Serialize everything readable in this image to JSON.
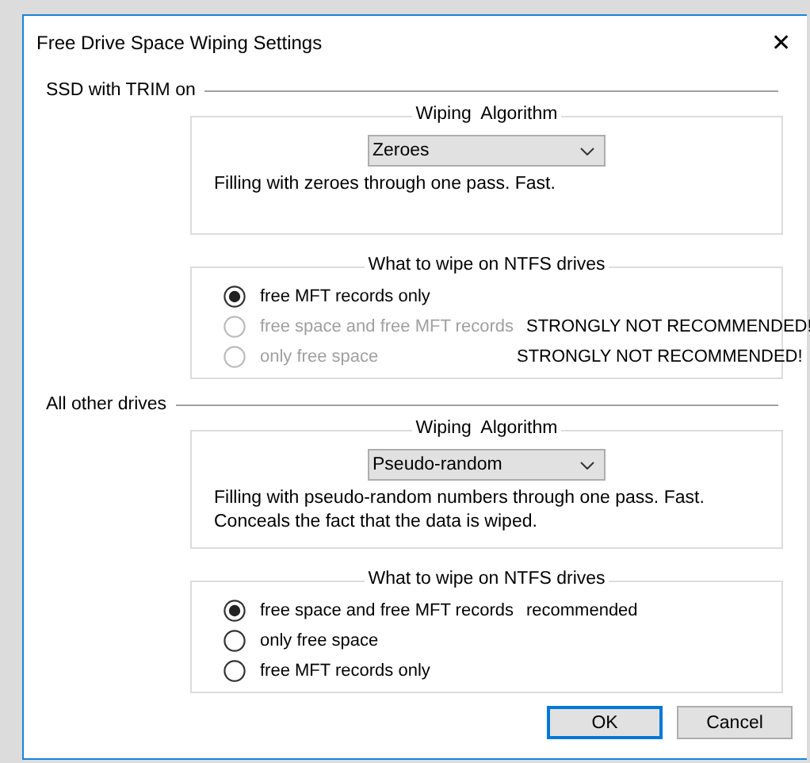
{
  "window": {
    "title": "Free Drive Space Wiping Settings",
    "close": "✕"
  },
  "sections": [
    {
      "title": "SSD with TRIM on",
      "algorithm": {
        "title": "Wiping  Algorithm",
        "value": "Zeroes",
        "description": "Filling with zeroes through one pass. Fast."
      },
      "ntfs": {
        "title": "What to wipe on NTFS drives",
        "options": [
          {
            "label": "free MFT records only",
            "selected": true,
            "disabled": false
          },
          {
            "label": "free space and free MFT records",
            "note": "STRONGLY NOT RECOMMENDED!",
            "selected": false,
            "disabled": true
          },
          {
            "label": "only free space",
            "note": "STRONGLY NOT RECOMMENDED!",
            "selected": false,
            "disabled": true
          }
        ]
      }
    },
    {
      "title": "All other drives",
      "algorithm": {
        "title": "Wiping  Algorithm",
        "value": "Pseudo-random",
        "description": "Filling with pseudo-random numbers through one pass. Fast.\nConceals the fact that the data is wiped."
      },
      "ntfs": {
        "title": "What to wipe on NTFS drives",
        "options": [
          {
            "label": "free space and free MFT records",
            "note": "recommended",
            "selected": true,
            "disabled": false
          },
          {
            "label": "only free space",
            "selected": false,
            "disabled": false
          },
          {
            "label": "free MFT records only",
            "selected": false,
            "disabled": false
          }
        ]
      }
    }
  ],
  "buttons": [
    {
      "label": "OK",
      "default": true
    },
    {
      "label": "Cancel",
      "default": false
    }
  ]
}
